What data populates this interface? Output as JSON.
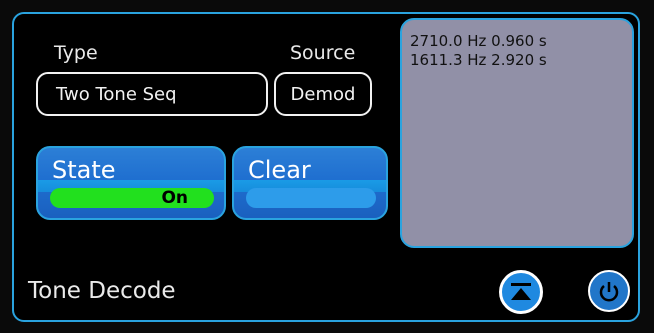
{
  "type": {
    "label": "Type",
    "value": "Two Tone Seq"
  },
  "source": {
    "label": "Source",
    "value": "Demod"
  },
  "state_button": {
    "label": "State",
    "status": "On"
  },
  "clear_button": {
    "label": "Clear"
  },
  "results": [
    {
      "text": "2710.0 Hz 0.960 s"
    },
    {
      "text": "1611.3 Hz 2.920 s"
    }
  ],
  "footer": {
    "title": "Tone Decode"
  },
  "icons": {
    "eject": "eject-icon",
    "power": "power-icon"
  },
  "colors": {
    "accent": "#2aa3df",
    "on": "#22e01e",
    "display_bg": "#9190a7"
  }
}
